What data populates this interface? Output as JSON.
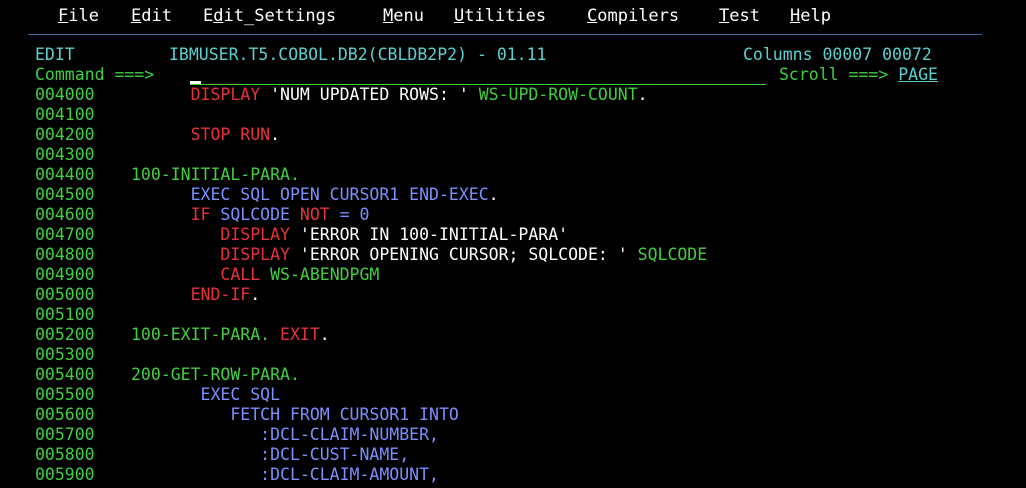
{
  "menu": [
    {
      "first": "F",
      "rest": "ile"
    },
    {
      "first": "E",
      "rest": "dit"
    },
    {
      "first": "E",
      "rest": "dit_Settings",
      "pre": "E",
      "firstIdx": 1
    },
    {
      "first": "M",
      "rest": "enu"
    },
    {
      "first": "U",
      "rest": "tilities"
    },
    {
      "first": "C",
      "rest": "ompilers"
    },
    {
      "first": "T",
      "rest": "est"
    },
    {
      "first": "H",
      "rest": "elp"
    }
  ],
  "menu_labels": [
    "File",
    "Edit",
    "Edit_Settings",
    "Menu",
    "Utilities",
    "Compilers",
    "Test",
    "Help"
  ],
  "header": {
    "mode": "EDIT",
    "dataset": "IBMUSER.T5.COBOL.DB2(CBLDB2P2) - 01.11",
    "columns_label": "Columns",
    "col_start": "00007",
    "col_end": "00072",
    "command_label": "Command ===>",
    "command_value": "",
    "scroll_label": "Scroll ===>",
    "scroll_value": "PAGE"
  },
  "lines": [
    {
      "seq": "004000",
      "segs": [
        [
          "      ",
          ""
        ],
        [
          "DISPLAY",
          "red"
        ],
        [
          " 'NUM UPDATED ROWS: ' ",
          "white"
        ],
        [
          "WS-UPD-ROW-COUNT",
          "green"
        ],
        [
          ".",
          "white"
        ]
      ]
    },
    {
      "seq": "004100",
      "segs": []
    },
    {
      "seq": "004200",
      "segs": [
        [
          "      ",
          ""
        ],
        [
          "STOP RUN",
          "red"
        ],
        [
          ".",
          "white"
        ]
      ]
    },
    {
      "seq": "004300",
      "segs": []
    },
    {
      "seq": "004400",
      "segs": [
        [
          "100-INITIAL-PARA.",
          "green"
        ]
      ]
    },
    {
      "seq": "004500",
      "segs": [
        [
          "      ",
          ""
        ],
        [
          "EXEC SQL OPEN CURSOR1 END-EXEC",
          "blue"
        ],
        [
          ".",
          "white"
        ]
      ]
    },
    {
      "seq": "004600",
      "segs": [
        [
          "      ",
          ""
        ],
        [
          "IF",
          "red"
        ],
        [
          " SQLCODE ",
          "blue"
        ],
        [
          "NOT",
          "red"
        ],
        [
          " = 0",
          "blue"
        ]
      ]
    },
    {
      "seq": "004700",
      "segs": [
        [
          "         ",
          ""
        ],
        [
          "DISPLAY",
          "red"
        ],
        [
          " 'ERROR IN 100-INITIAL-PARA'",
          "white"
        ]
      ]
    },
    {
      "seq": "004800",
      "segs": [
        [
          "         ",
          ""
        ],
        [
          "DISPLAY",
          "red"
        ],
        [
          " 'ERROR OPENING CURSOR; SQLCODE: ' ",
          "white"
        ],
        [
          "SQLCODE",
          "green"
        ]
      ]
    },
    {
      "seq": "004900",
      "segs": [
        [
          "         ",
          ""
        ],
        [
          "CALL",
          "red"
        ],
        [
          " WS-ABENDPGM",
          "green"
        ]
      ]
    },
    {
      "seq": "005000",
      "segs": [
        [
          "      ",
          ""
        ],
        [
          "END-IF",
          "red"
        ],
        [
          ".",
          "white"
        ]
      ]
    },
    {
      "seq": "005100",
      "segs": []
    },
    {
      "seq": "005200",
      "segs": [
        [
          "100-EXIT-PARA. ",
          "green"
        ],
        [
          "EXIT",
          "red"
        ],
        [
          ".",
          "white"
        ]
      ]
    },
    {
      "seq": "005300",
      "segs": []
    },
    {
      "seq": "005400",
      "segs": [
        [
          "200-GET-ROW-PARA.",
          "green"
        ]
      ]
    },
    {
      "seq": "005500",
      "segs": [
        [
          "       ",
          ""
        ],
        [
          "EXEC SQL",
          "blue"
        ]
      ]
    },
    {
      "seq": "005600",
      "segs": [
        [
          "          ",
          ""
        ],
        [
          "FETCH FROM CURSOR1 INTO",
          "blue"
        ]
      ]
    },
    {
      "seq": "005700",
      "segs": [
        [
          "             ",
          ""
        ],
        [
          ":DCL-CLAIM-NUMBER,",
          "blue"
        ]
      ]
    },
    {
      "seq": "005800",
      "segs": [
        [
          "             ",
          ""
        ],
        [
          ":DCL-CUST-NAME,",
          "blue"
        ]
      ]
    },
    {
      "seq": "005900",
      "segs": [
        [
          "             ",
          ""
        ],
        [
          ":DCL-CLAIM-AMOUNT,",
          "blue"
        ]
      ]
    }
  ]
}
